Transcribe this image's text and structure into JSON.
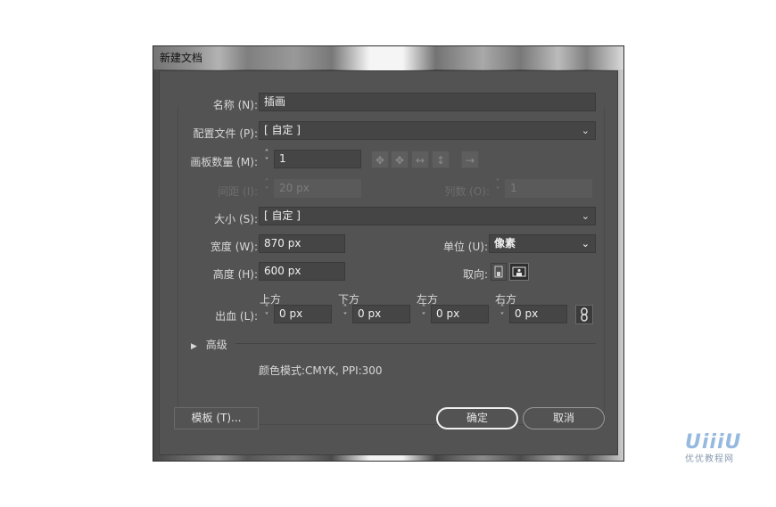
{
  "window": {
    "title": "新建文档"
  },
  "form": {
    "name": {
      "label": "名称 (N):",
      "value": "插画"
    },
    "profile": {
      "label": "配置文件 (P):",
      "value": "[ 自定 ]"
    },
    "artboards": {
      "label": "画板数量 (M):",
      "value": "1",
      "tool_icons": [
        "grid-by-row-icon",
        "grid-by-column-icon",
        "arrange-row-icon",
        "arrange-column-icon",
        "right-to-left-icon"
      ]
    },
    "spacing": {
      "label": "间距 (I):",
      "value": "20 px"
    },
    "columns": {
      "label": "列数 (O):",
      "value": "1"
    },
    "size": {
      "label": "大小 (S):",
      "value": "[ 自定 ]"
    },
    "width": {
      "label": "宽度 (W):",
      "value": "870 px"
    },
    "units": {
      "label": "单位 (U):",
      "value": "像素"
    },
    "height": {
      "label": "高度 (H):",
      "value": "600 px"
    },
    "orientation": {
      "label": "取向:",
      "selected": "landscape"
    },
    "bleed": {
      "label": "出血 (L):",
      "top": {
        "label": "上方",
        "value": "0 px"
      },
      "bottom": {
        "label": "下方",
        "value": "0 px"
      },
      "left": {
        "label": "左方",
        "value": "0 px"
      },
      "right": {
        "label": "右方",
        "value": "0 px"
      }
    },
    "advanced": {
      "label": "高级"
    },
    "color_info": "颜色模式:CMYK, PPI:300"
  },
  "buttons": {
    "templates": "模板 (T)...",
    "ok": "确定",
    "cancel": "取消"
  },
  "watermark": {
    "logo": "UiiiU",
    "caption": "优优教程网"
  }
}
